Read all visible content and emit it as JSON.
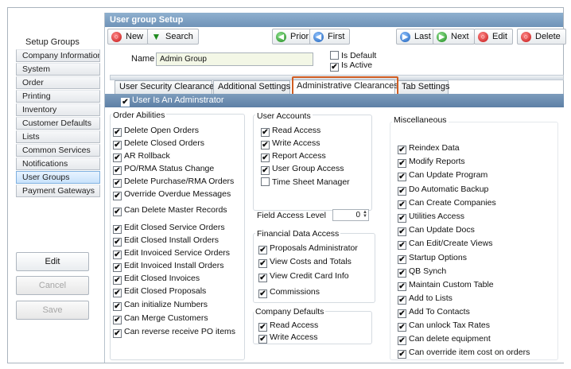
{
  "left": {
    "title": "Setup Groups",
    "nav": [
      "Company Information",
      "System",
      "Order",
      "Printing",
      "Inventory",
      "Customer Defaults",
      "Lists",
      "Common Services",
      "Notifications",
      "User Groups",
      "Payment Gateways"
    ],
    "active_index": 9,
    "buttons": {
      "edit": "Edit",
      "cancel": "Cancel",
      "save": "Save"
    }
  },
  "window": {
    "title": "User group Setup"
  },
  "toolbar": {
    "new": "New",
    "search": "Search",
    "prior": "Prior",
    "first": "First",
    "last": "Last",
    "next": "Next",
    "edit": "Edit",
    "delete": "Delete"
  },
  "form": {
    "name_label": "Name",
    "name_value": "Admin Group",
    "is_default_label": "Is Default",
    "is_default": false,
    "is_active_label": "Is Active",
    "is_active": true
  },
  "tabs": [
    "User Security Clearances",
    "Additional Settings",
    "Administrative Clearances",
    "Tab Settings"
  ],
  "active_tab": 2,
  "subheader": {
    "label": "User Is An Adminstrator",
    "checked": true
  },
  "order_abilities": {
    "title": "Order Abilities",
    "items": [
      {
        "label": "Delete Open Orders",
        "checked": true
      },
      {
        "label": "Delete Closed Orders",
        "checked": true
      },
      {
        "label": "AR Rollback",
        "checked": true
      },
      {
        "label": "PO/RMA Status Change",
        "checked": true
      },
      {
        "label": "Delete Purchase/RMA Orders",
        "checked": true
      },
      {
        "label": "Override Overdue Messages",
        "checked": true
      },
      {
        "label": "Can Delete Master Records",
        "checked": true
      },
      {
        "label": "Edit Closed Service Orders",
        "checked": true
      },
      {
        "label": "Edit Closed Install Orders",
        "checked": true
      },
      {
        "label": "Edit Invoiced Service Orders",
        "checked": true
      },
      {
        "label": "Edit Invoiced Install Orders",
        "checked": true
      },
      {
        "label": "Edit Closed Invoices",
        "checked": true
      },
      {
        "label": "Edit Closed Proposals",
        "checked": true
      },
      {
        "label": "Can initialize Numbers",
        "checked": true
      },
      {
        "label": "Can Merge Customers",
        "checked": true
      },
      {
        "label": "Can reverse receive PO items",
        "checked": true
      }
    ]
  },
  "user_accounts": {
    "title": "User Accounts",
    "items": [
      {
        "label": "Read Access",
        "checked": true
      },
      {
        "label": "Write Access",
        "checked": true
      },
      {
        "label": "Report Access",
        "checked": true
      },
      {
        "label": "User Group Access",
        "checked": true
      },
      {
        "label": "Time Sheet Manager",
        "checked": false
      }
    ],
    "field_access_label": "Field Access Level",
    "field_access_value": "0"
  },
  "financial": {
    "title": "Financial Data Access",
    "items": [
      {
        "label": "Proposals Administrator",
        "checked": true
      },
      {
        "label": "View Costs and Totals",
        "checked": true
      },
      {
        "label": "View Credit Card Info",
        "checked": true
      },
      {
        "label": "Commissions",
        "checked": true
      }
    ]
  },
  "company_defaults": {
    "title": "Company Defaults",
    "items": [
      {
        "label": "Read Access",
        "checked": true
      },
      {
        "label": "Write Access",
        "checked": true
      }
    ]
  },
  "misc": {
    "title": "Miscellaneous",
    "items": [
      {
        "label": "Reindex Data",
        "checked": true
      },
      {
        "label": "Modify Reports",
        "checked": true
      },
      {
        "label": "Can Update Program",
        "checked": true
      },
      {
        "label": "Do Automatic Backup",
        "checked": true
      },
      {
        "label": "Can Create Companies",
        "checked": true
      },
      {
        "label": "Utilities Access",
        "checked": true
      },
      {
        "label": "Can Update Docs",
        "checked": true
      },
      {
        "label": "Can Edit/Create Views",
        "checked": true
      },
      {
        "label": "Startup Options",
        "checked": true
      },
      {
        "label": "QB Synch",
        "checked": true
      },
      {
        "label": "Maintain Custom Table",
        "checked": true
      },
      {
        "label": "Add to Lists",
        "checked": true
      },
      {
        "label": "Add To Contacts",
        "checked": true
      },
      {
        "label": "Can unlock Tax Rates",
        "checked": true
      },
      {
        "label": "Can delete equipment",
        "checked": true
      },
      {
        "label": "Can override item cost on orders",
        "checked": true
      }
    ]
  },
  "colors": {
    "accent": "#6f93b8",
    "highlight": "#d05d22"
  }
}
